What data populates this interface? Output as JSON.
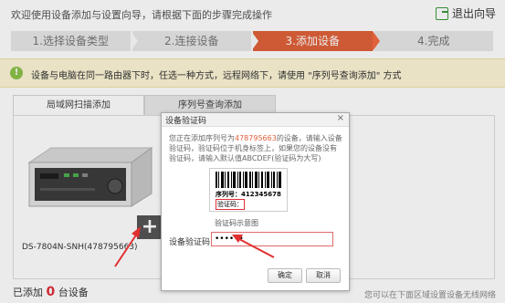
{
  "header": {
    "welcome": "欢迎使用设备添加与设置向导，请根据下面的步骤完成操作",
    "exit_label": "退出向导"
  },
  "steps": [
    {
      "label": "1.选择设备类型",
      "active": false
    },
    {
      "label": "2.连接设备",
      "active": false
    },
    {
      "label": "3.添加设备",
      "active": true
    },
    {
      "label": "4.完成",
      "active": false
    }
  ],
  "notice": {
    "icon": "!",
    "text": "设备与电脑在同一路由器下时，任选一种方式，远程网络下，请使用 \"序列号查询添加\" 方式"
  },
  "tabs": [
    {
      "label": "局域网扫描添加",
      "active": true
    },
    {
      "label": "序列号查询添加",
      "active": false
    }
  ],
  "device": {
    "label": "DS-7804N-SNH(478795663)",
    "add_symbol": "+"
  },
  "footer": {
    "added_prefix": "已添加",
    "added_count": "0",
    "added_suffix": "台设备",
    "hint": "您可以在下面区域设置设备无线网络"
  },
  "dialog": {
    "title": "设备验证码",
    "close_symbol": "×",
    "desc_before": "您正在添加序列号为",
    "desc_serial": "478795663",
    "desc_after": "的设备，请输入设备验证码，验证码位于机身标签上，如果您的设备没有验证码，请输入默认值ABCDEF(验证码为大写)",
    "barcode_serial": "序列号：412345678",
    "barcode_verify": "验证码：",
    "barcode_caption": "验证码示意图",
    "code_label": "设备验证码：",
    "code_value": "••••••",
    "ok_label": "确定",
    "cancel_label": "取消"
  },
  "colors": {
    "accent": "#e0613a",
    "notice_bg": "#fdf6d6",
    "exit_icon": "#3a9a3a"
  }
}
